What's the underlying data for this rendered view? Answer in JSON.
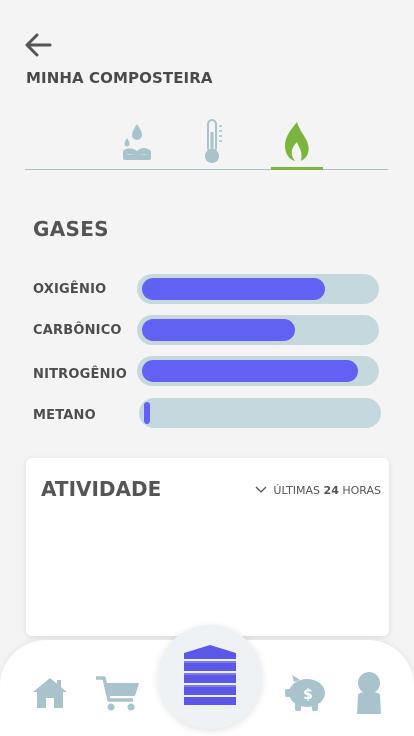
{
  "header": {
    "title": "MINHA COMPOSTEIRA"
  },
  "tabs": [
    {
      "name": "humidity",
      "icon": "water-drops-icon",
      "active": false
    },
    {
      "name": "temperature",
      "icon": "thermometer-icon",
      "active": false
    },
    {
      "name": "gases",
      "icon": "flame-icon",
      "active": true
    }
  ],
  "gases": {
    "title": "GASES",
    "items": [
      {
        "label": "OXIGÊNIO",
        "level": 0.79
      },
      {
        "label": "CARBÔNICO",
        "level": 0.66
      },
      {
        "label": "NITROGÊNIO",
        "level": 0.93
      },
      {
        "label": "METANO",
        "level": 0.02
      }
    ]
  },
  "activity": {
    "title": "ATIVIDADE",
    "period_prefix": "ÚLTIMAS",
    "period_value": "24",
    "period_suffix": "HORAS"
  },
  "bottom_nav": [
    {
      "name": "home",
      "icon": "house-icon"
    },
    {
      "name": "shop",
      "icon": "shopping-cart-icon"
    },
    {
      "name": "composter",
      "icon": "composter-icon",
      "active": true
    },
    {
      "name": "savings",
      "icon": "piggy-bank-icon"
    },
    {
      "name": "profile",
      "icon": "user-icon"
    }
  ],
  "colors": {
    "accent_green": "#7ab53d",
    "bar_fill": "#6161f4",
    "bar_track": "#c5d8de",
    "icon_muted": "#a9c3cd"
  }
}
